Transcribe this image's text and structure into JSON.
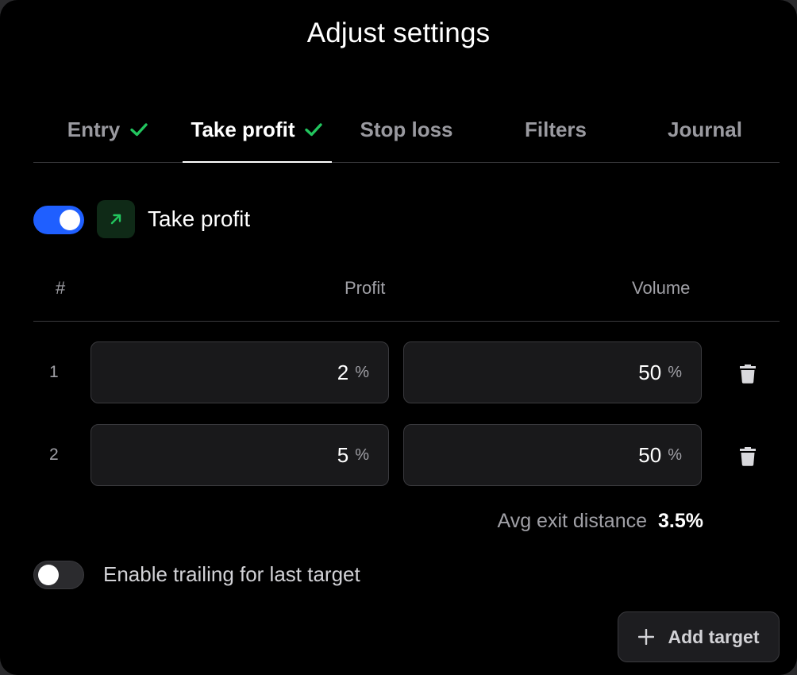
{
  "dialog": {
    "title": "Adjust settings"
  },
  "tabs": [
    {
      "label": "Entry",
      "completed": true,
      "active": false
    },
    {
      "label": "Take profit",
      "completed": true,
      "active": true
    },
    {
      "label": "Stop loss",
      "completed": false,
      "active": false
    },
    {
      "label": "Filters",
      "completed": false,
      "active": false
    },
    {
      "label": "Journal",
      "completed": false,
      "active": false
    }
  ],
  "section": {
    "title": "Take profit",
    "enabled": true,
    "icon": "arrow-up-right-icon"
  },
  "table": {
    "headers": {
      "index": "#",
      "profit": "Profit",
      "volume": "Volume"
    },
    "rows": [
      {
        "index": "1",
        "profit": "2",
        "profit_unit": "%",
        "volume": "50",
        "volume_unit": "%"
      },
      {
        "index": "2",
        "profit": "5",
        "profit_unit": "%",
        "volume": "50",
        "volume_unit": "%"
      }
    ]
  },
  "summary": {
    "label": "Avg exit distance",
    "value": "3.5%"
  },
  "trailing": {
    "label": "Enable trailing for last target",
    "enabled": false
  },
  "actions": {
    "add_target_label": "Add target"
  },
  "colors": {
    "background": "#000000",
    "accent_blue": "#1f5fff",
    "check_green": "#22c55e",
    "field_bg": "#19191b"
  }
}
